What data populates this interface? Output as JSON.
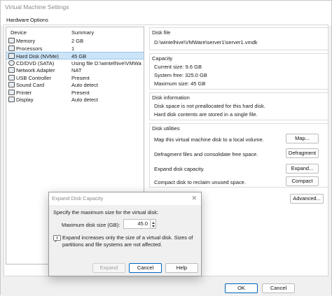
{
  "window": {
    "title": "Virtual Machine Settings"
  },
  "tabs": [
    {
      "label": "Hardware"
    },
    {
      "label": "Options"
    }
  ],
  "device_list": {
    "headers": {
      "device": "Device",
      "summary": "Summary"
    },
    "rows": [
      {
        "name": "Memory",
        "summary": "2 GB",
        "icon": "memory-icon"
      },
      {
        "name": "Processors",
        "summary": "1",
        "icon": "processor-icon"
      },
      {
        "name": "Hard Disk (NVMe)",
        "summary": "45 GB",
        "icon": "hard-disk-icon"
      },
      {
        "name": "CD/DVD (SATA)",
        "summary": "Using file D:\\wintelhive\\VMWa...",
        "icon": "cd-dvd-icon"
      },
      {
        "name": "Network Adapter",
        "summary": "NAT",
        "icon": "network-adapter-icon"
      },
      {
        "name": "USB Controller",
        "summary": "Present",
        "icon": "usb-icon"
      },
      {
        "name": "Sound Card",
        "summary": "Auto detect",
        "icon": "sound-card-icon"
      },
      {
        "name": "Printer",
        "summary": "Present",
        "icon": "printer-icon"
      },
      {
        "name": "Display",
        "summary": "Auto detect",
        "icon": "display-icon"
      }
    ]
  },
  "disk_file": {
    "title": "Disk file",
    "path": "D:\\wintelhive\\VMWare\\server1\\server1.vmdk"
  },
  "capacity": {
    "title": "Capacity",
    "current": "Current size: 9.6 GB",
    "free": "System free: 325.0 GB",
    "maximum": "Maximum size: 45 GB"
  },
  "disk_info": {
    "title": "Disk information",
    "line1": "Disk space is not preallocated for this hard disk.",
    "line2": "Hard disk contents are stored in a single file."
  },
  "disk_utilities": {
    "title": "Disk utilities",
    "map_text": "Map this virtual machine disk to a local volume.",
    "map_button": "Map...",
    "defrag_text": "Defragment files and consolidate free space.",
    "defrag_button": "Defragment",
    "expand_text": "Expand disk capacity.",
    "expand_button": "Expand...",
    "compact_text": "Compact disk to reclaim unused space.",
    "compact_button": "Compact"
  },
  "advanced_button": "Advanced...",
  "footer": {
    "ok": "OK",
    "cancel": "Cancel"
  },
  "dialog": {
    "title": "Expand Disk Capacity",
    "instruction": "Specify the maximum size for the virtual disk:",
    "size_label": "Maximum disk size (GB):",
    "size_value": "45.0",
    "note_line1": "Expand increases only the size of a virtual disk. Sizes of",
    "note_line2": "partitions and file systems are not affected.",
    "expand_button": "Expand",
    "cancel_button": "Cancel",
    "help_button": "Help",
    "close_glyph": "✕"
  }
}
